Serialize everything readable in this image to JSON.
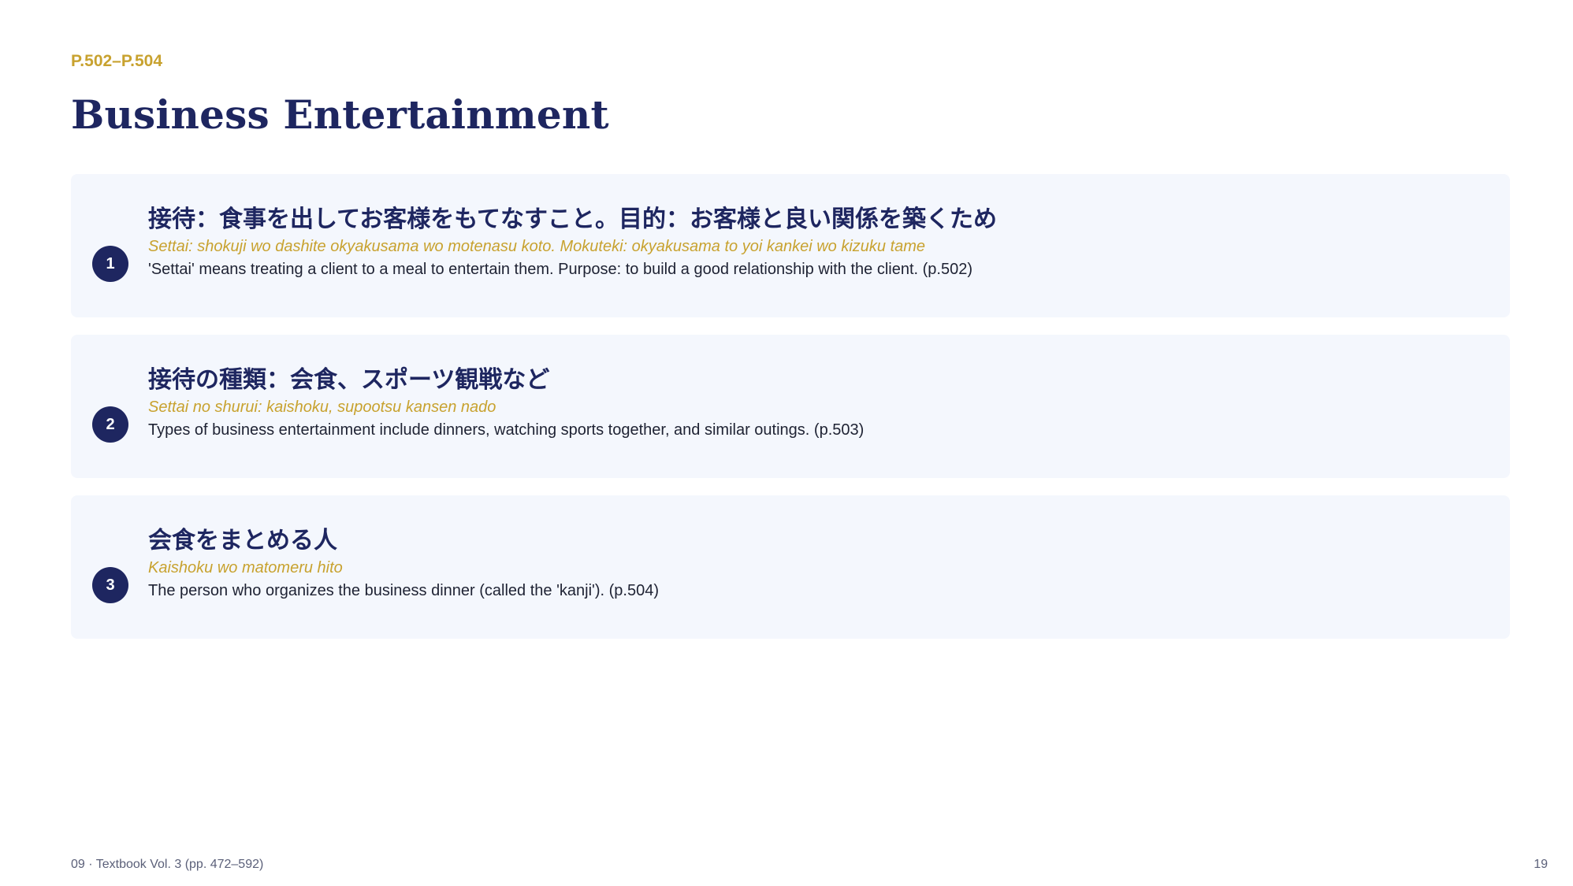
{
  "header": {
    "page_range": "P.502–P.504",
    "title": "Business Entertainment"
  },
  "items": [
    {
      "number": "1",
      "japanese": "接待：食事を出してお客様をもてなすこと。目的：お客様と良い関係を築くため",
      "romaji": "Settai: shokuji wo dashite okyakusama wo motenasu koto. Mokuteki: okyakusama to yoi kankei wo kizuku tame",
      "english": "'Settai' means treating a client to a meal to entertain them. Purpose: to build a good relationship with the client. (p.502)"
    },
    {
      "number": "2",
      "japanese": "接待の種類：会食、スポーツ観戦など",
      "romaji": "Settai no shurui: kaishoku, supootsu kansen nado",
      "english": "Types of business entertainment include dinners, watching sports together, and similar outings. (p.503)"
    },
    {
      "number": "3",
      "japanese": "会食をまとめる人",
      "romaji": "Kaishoku wo matomeru hito",
      "english": "The person who organizes the business dinner (called the 'kanji'). (p.504)"
    }
  ],
  "footer": {
    "source": "09 · Textbook Vol. 3 (pp. 472–592)",
    "slide_number": "19"
  },
  "colors": {
    "navy": "#1e2660",
    "gold": "#c8a22f",
    "card_background": "#f4f7fd"
  }
}
